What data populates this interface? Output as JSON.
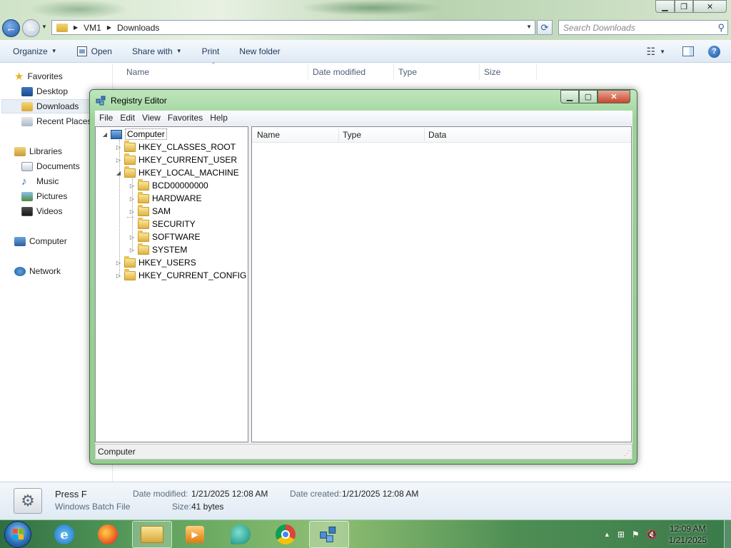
{
  "explorer": {
    "breadcrumb": [
      "VM1",
      "Downloads"
    ],
    "search_placeholder": "Search Downloads",
    "toolbar": {
      "organize": "Organize",
      "open": "Open",
      "share_with": "Share with",
      "print": "Print",
      "new_folder": "New folder"
    },
    "nav": {
      "favorites": "Favorites",
      "desktop": "Desktop",
      "downloads": "Downloads",
      "recent_places": "Recent Places",
      "libraries": "Libraries",
      "documents": "Documents",
      "music": "Music",
      "pictures": "Pictures",
      "videos": "Videos",
      "computer": "Computer",
      "network": "Network"
    },
    "columns": [
      "Name",
      "Date modified",
      "Type",
      "Size"
    ],
    "details": {
      "file_name": "Press F",
      "file_type": "Windows Batch File",
      "date_modified_label": "Date modified:",
      "date_modified": "1/21/2025 12:08 AM",
      "date_created_label": "Date created:",
      "date_created": "1/21/2025 12:08 AM",
      "size_label": "Size:",
      "size": "41 bytes"
    }
  },
  "regedit": {
    "title": "Registry Editor",
    "menu": [
      "File",
      "Edit",
      "View",
      "Favorites",
      "Help"
    ],
    "tree": {
      "root": "Computer",
      "hives": [
        "HKEY_CLASSES_ROOT",
        "HKEY_CURRENT_USER",
        "HKEY_LOCAL_MACHINE",
        "HKEY_USERS",
        "HKEY_CURRENT_CONFIG"
      ],
      "hklm_children": [
        "BCD00000000",
        "HARDWARE",
        "SAM",
        "SECURITY",
        "SOFTWARE",
        "SYSTEM"
      ]
    },
    "list_columns": [
      "Name",
      "Type",
      "Data"
    ],
    "status": "Computer"
  },
  "taskbar": {
    "apps": [
      "internet-explorer",
      "firefox",
      "windows-explorer",
      "media-player",
      "chat",
      "chrome",
      "regedit"
    ],
    "clock_time": "12:09 AM",
    "clock_date": "1/21/2025"
  }
}
